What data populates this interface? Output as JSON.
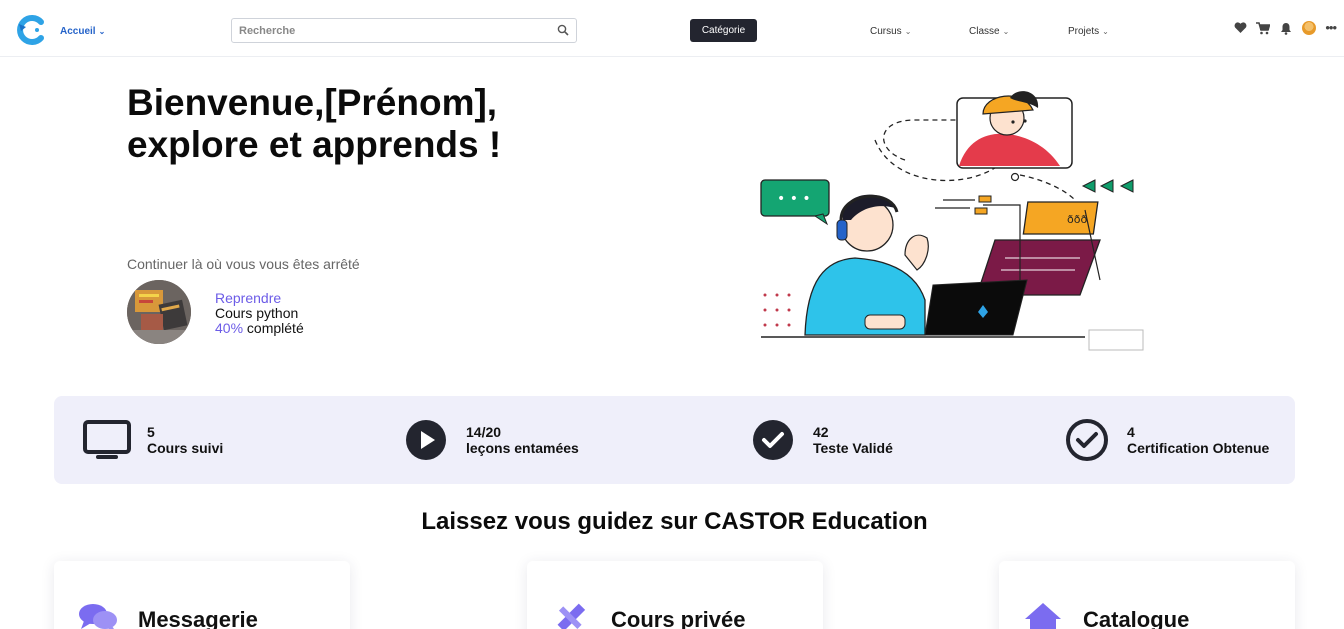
{
  "header": {
    "home_label": "Accueil",
    "search_placeholder": "Recherche",
    "category_label": "Catégorie",
    "nav_items": [
      "Cursus",
      "Classe",
      "Projets"
    ],
    "icons": [
      "heart-icon",
      "cart-icon",
      "bell-icon",
      "user-avatar",
      "more-icon"
    ]
  },
  "hero": {
    "title_line1": "Bienvenue,[Prénom],",
    "title_line2": "explore et apprends !",
    "continue_label": "Continuer là où vous vous êtes arrêté",
    "resume_label": "Reprendre",
    "course_name": "Cours python",
    "progress_pct": "40%",
    "progress_suffix": " complété"
  },
  "stats": [
    {
      "value": "5",
      "label": "Cours suivi",
      "icon": "monitor-icon"
    },
    {
      "value": "14/20",
      "label": "leçons entamées",
      "icon": "play-icon"
    },
    {
      "value": "42",
      "label": "Teste Validé",
      "icon": "check-filled-icon"
    },
    {
      "value": "4",
      "label": "Certification Obtenue",
      "icon": "check-outline-icon"
    }
  ],
  "section": {
    "title": "Laissez vous guidez sur CASTOR Education"
  },
  "cards": [
    {
      "title": "Messagerie",
      "icon": "chat-icon"
    },
    {
      "title": "Cours privée",
      "icon": "pencil-ruler-icon"
    },
    {
      "title": "Catalogue",
      "icon": "home-icon"
    }
  ],
  "colors": {
    "accent": "#6c5ce7",
    "brand_blue": "#2563c9",
    "dark": "#23252f",
    "stats_bg": "#efeffa"
  }
}
